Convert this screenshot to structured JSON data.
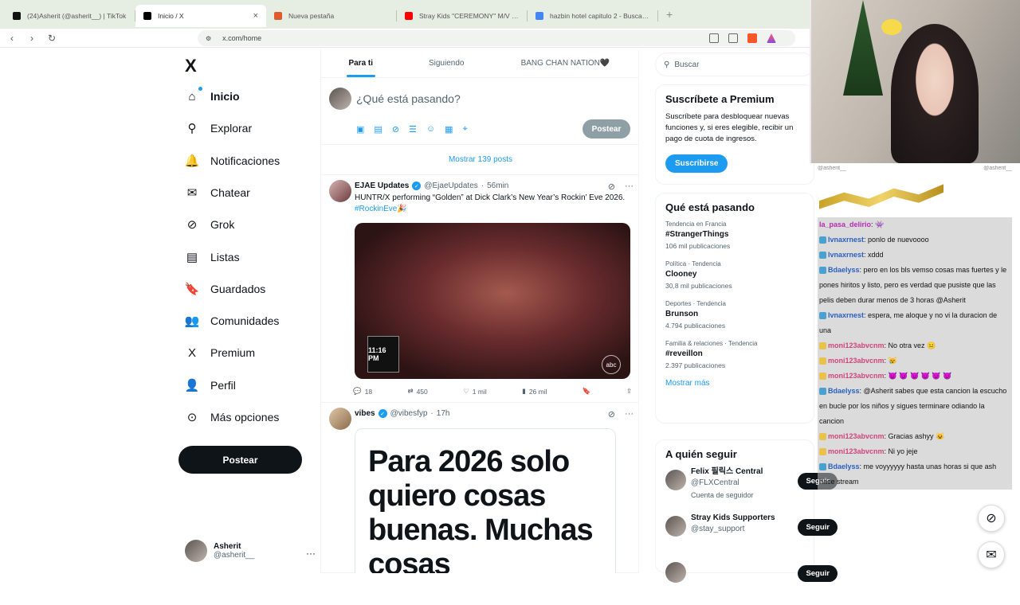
{
  "browser": {
    "tabs": [
      {
        "title": "(24)Asherit (@asherit__) | TikTok",
        "color": "#111111"
      },
      {
        "title": "Inicio / X",
        "color": "#000000",
        "active": true
      },
      {
        "title": "Nueva pestaña",
        "color": "#e05a2b"
      },
      {
        "title": "Stray Kids \"CEREMONY\" M/V - YouTube",
        "color": "#ff0000"
      },
      {
        "title": "hazbin hotel capitulo 2 - Buscar con Google",
        "color": "#4285f4"
      }
    ],
    "url": "x.com/home"
  },
  "sidebar": {
    "logo": "X",
    "items": [
      {
        "label": "Inicio",
        "icon": "home-icon",
        "glyph": "⌂"
      },
      {
        "label": "Explorar",
        "icon": "search-icon",
        "glyph": "⚲"
      },
      {
        "label": "Notificaciones",
        "icon": "bell-icon",
        "glyph": "🔔"
      },
      {
        "label": "Chatear",
        "icon": "mail-icon",
        "glyph": "✉"
      },
      {
        "label": "Grok",
        "icon": "grok-icon",
        "glyph": "⊘"
      },
      {
        "label": "Listas",
        "icon": "list-icon",
        "glyph": "▤"
      },
      {
        "label": "Guardados",
        "icon": "bookmark-icon",
        "glyph": "🔖"
      },
      {
        "label": "Comunidades",
        "icon": "people-icon",
        "glyph": "👥"
      },
      {
        "label": "Premium",
        "icon": "x-icon",
        "glyph": "X"
      },
      {
        "label": "Perfil",
        "icon": "person-icon",
        "glyph": "👤"
      },
      {
        "label": "Más opciones",
        "icon": "more-icon",
        "glyph": "⊙"
      }
    ],
    "post_button": "Postear",
    "account": {
      "name": "Asherit",
      "handle": "@asherit__"
    }
  },
  "feed": {
    "tabs": [
      "Para ti",
      "Siguiendo",
      "BANG CHAN NATION🖤"
    ],
    "compose_placeholder": "¿Qué está pasando?",
    "compose_button": "Postear",
    "show_posts": "Mostrar 139 posts",
    "posts": [
      {
        "name": "EJAE Updates",
        "handle": "@EjaeUpdates",
        "time": "56min",
        "text": "HUNTR/X performing “Golden” at Dick Clark’s New Year’s Rockin’ Eve 2026. ",
        "hashtag": "#RockinEve🎉",
        "media_overlay": "11:16 PM",
        "media_watermark": "abc",
        "stats": {
          "replies": "18",
          "reposts": "450",
          "likes": "1 mil",
          "views": "26 mil"
        }
      },
      {
        "name": "vibes",
        "handle": "@vibesfyp",
        "time": "17h",
        "image_text": "Para 2026 solo quiero cosas buenas. Muchas cosas"
      }
    ]
  },
  "right": {
    "search_placeholder": "Buscar",
    "premium": {
      "title": "Suscríbete a Premium",
      "text": "Suscríbete para desbloquear nuevas funciones y, si eres elegible, recibir un pago de cuota de ingresos.",
      "button": "Suscribirse"
    },
    "trends_title": "Qué está pasando",
    "trends": [
      {
        "context": "Tendencia en Francia",
        "topic": "#StrangerThings",
        "count": "106 mil publicaciones"
      },
      {
        "context": "Política · Tendencia",
        "topic": "Clooney",
        "count": "30,8 mil publicaciones"
      },
      {
        "context": "Deportes · Tendencia",
        "topic": "Brunson",
        "count": "4.794 publicaciones"
      },
      {
        "context": "Familia & relaciones · Tendencia",
        "topic": "#reveillon",
        "count": "2.397 publicaciones"
      }
    ],
    "show_more": "Mostrar más",
    "follow_title": "A quién seguir",
    "follow": [
      {
        "name": "Felix 필릭스 Central",
        "handle": "@FLXCentral",
        "extra": "Cuenta de seguidor",
        "button": "Seguir"
      },
      {
        "name": "Stray Kids Supporters",
        "handle": "@stay_support",
        "extra": "",
        "button": "Seguir"
      },
      {
        "name": "",
        "handle": "",
        "extra": "",
        "button": "Seguir"
      }
    ]
  },
  "stream": {
    "overlay_left": "@asherit__",
    "overlay_right": "@asherit__",
    "chat": [
      {
        "user": "la_pasa_delirio",
        "text": ": 👾",
        "badge": ""
      },
      {
        "user": "lvnaxrnest",
        "text": ": ponlo de nuevoooo",
        "badge": "b"
      },
      {
        "user": "lvnaxrnest",
        "text": ": xddd",
        "badge": "b"
      },
      {
        "user": "Bdaelyss",
        "text": ": pero en los bls vemso cosas mas fuertes y le pones hiritos y listo, pero es verdad que pusiste que las pelis deben durar menos de 3 horas @Asherit",
        "badge": "b"
      },
      {
        "user": "lvnaxrnest",
        "text": ": espera, me aloque y no vi la duracion de una",
        "badge": "b"
      },
      {
        "user": "moni123abvcnm",
        "text": ": No otra vez 😐",
        "badge": "g"
      },
      {
        "user": "moni123abvcnm",
        "text": ": 😿",
        "badge": "g"
      },
      {
        "user": "moni123abvcnm",
        "text": ": 😈 😈 😈 😈 😈 😈",
        "badge": "g"
      },
      {
        "user": "Bdaelyss",
        "text": ": @Asherit sabes que esta cancion la escucho en bucle por los niños y sigues terminare odiando la cancion",
        "badge": "b"
      },
      {
        "user": "moni123abvcnm",
        "text": ": Gracias ashyy 😺",
        "badge": "g"
      },
      {
        "user": "moni123abvcnm",
        "text": ": Ni yo jeje",
        "badge": "g"
      },
      {
        "user": "Bdaelyss",
        "text": ": me voyyyyyy hasta unas horas si que ash hace stream",
        "badge": "b"
      }
    ]
  }
}
